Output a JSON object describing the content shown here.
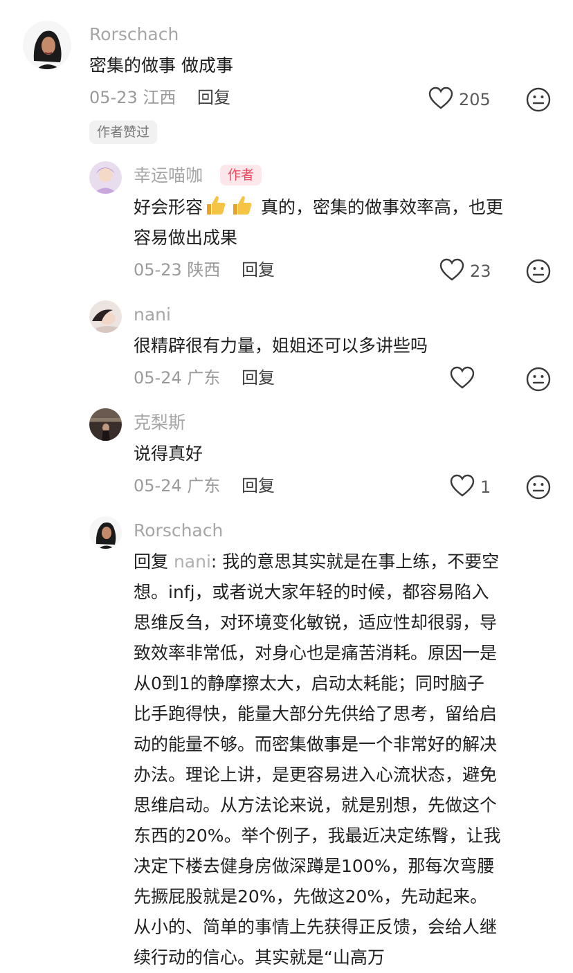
{
  "comments": [
    {
      "user": "Rorschach",
      "text": "密集的做事 做成事",
      "date": "05-23",
      "location": "江西",
      "reply_label": "回复",
      "likes": "205",
      "author_liked_badge": "作者赞过"
    }
  ],
  "replies": [
    {
      "user": "幸运喵咖",
      "author_tag": "作者",
      "text_before_emoji": "好会形容",
      "emoji_names": [
        "thumbs-up-icon",
        "thumbs-up-icon"
      ],
      "text_after_emoji": "真的，密集的做事效率高，也更",
      "text_line2": "容易做出成果",
      "date": "05-23",
      "location": "陕西",
      "reply_label": "回复",
      "likes": "23"
    },
    {
      "user": "nani",
      "text": "很精辟很有力量，姐姐还可以多讲些吗",
      "date": "05-24",
      "location": "广东",
      "reply_label": "回复",
      "likes": ""
    },
    {
      "user": "克梨斯",
      "text": "说得真好",
      "date": "05-24",
      "location": "广东",
      "reply_label": "回复",
      "likes": "1"
    },
    {
      "user": "Rorschach",
      "reply_prefix": "回复 ",
      "mention": "nani",
      "lines": [
        ": 我的意思其实就是在事上练，不要空",
        "想。infj，或者说大家年轻的时候，都容易陷入",
        "思维反刍，对环境变化敏锐，适应性却很弱，导",
        "致效率非常低，对身心也是痛苦消耗。原因一是",
        "从0到1的静摩擦太大，启动太耗能；同时脑子",
        "比手跑得快，能量大部分先供给了思考，留给启",
        "动的能量不够。而密集做事是一个非常好的解决",
        "办法。理论上讲，是更容易进入心流状态，避免",
        "思维启动。从方法论来说，就是别想，先做这个",
        "东西的20%。举个例子，我最近决定练臀，让我",
        "决定下楼去健身房做深蹲是100%，那每次弯腰",
        "先撅屁股就是20%，先做这20%，先动起来。",
        "从小的、简单的事情上先获得正反馈，会给人继",
        "续行动的信心。其实就是“山高万"
      ]
    }
  ],
  "icons": {
    "like": "heart-outline-icon",
    "dislike": "neutral-face-icon"
  },
  "colors": {
    "username": "#a6a6a6",
    "meta": "#9a9a9a",
    "author_tag_bg": "#fde7ea",
    "author_tag_text": "#ef4a62"
  }
}
